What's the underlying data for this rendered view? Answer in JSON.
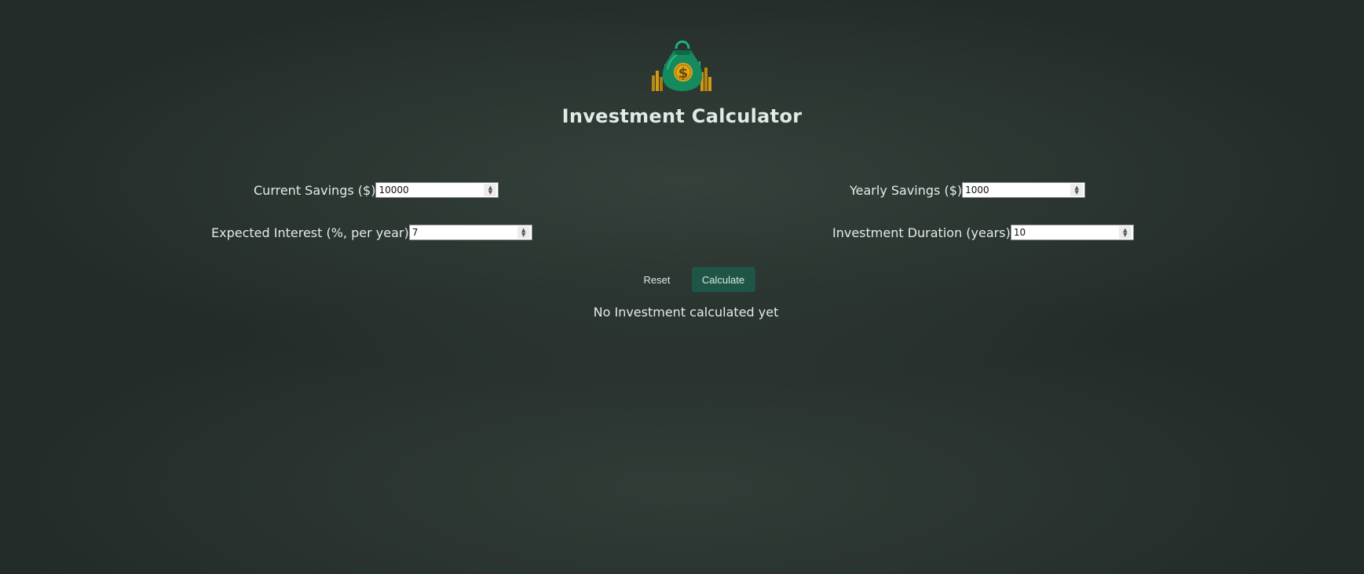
{
  "app": {
    "title": "Investment Calculator",
    "logo_icon": "money-bag-icon"
  },
  "form": {
    "current_savings": {
      "label": "Current Savings ($)",
      "value": "10000"
    },
    "yearly_savings": {
      "label": "Yearly Savings ($)",
      "value": "1000"
    },
    "expected_interest": {
      "label": "Expected Interest (%, per year)",
      "value": "7"
    },
    "investment_duration": {
      "label": "Investment Duration (years)",
      "value": "10"
    }
  },
  "actions": {
    "reset_label": "Reset",
    "calculate_label": "Calculate"
  },
  "result": {
    "empty_text": "No Investment calculated yet"
  },
  "colors": {
    "background": "#232b28",
    "accent_button": "#1f5547",
    "text": "#e4ece8"
  }
}
